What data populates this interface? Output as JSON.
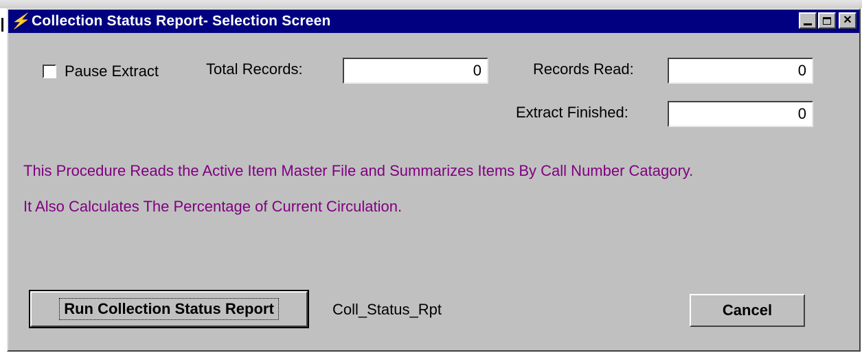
{
  "window": {
    "title": "Collection Status Report- Selection Screen",
    "title_icon": "lightning-icon",
    "controls": [
      "minimize-icon",
      "maximize-icon",
      "close-icon"
    ],
    "close_glyph": "✕"
  },
  "form": {
    "pause_extract_label": "Pause Extract",
    "pause_extract_checked": false,
    "total_records_label": "Total Records:",
    "total_records_value": "0",
    "records_read_label": "Records Read:",
    "records_read_value": "0",
    "extract_finished_label": "Extract Finished:",
    "extract_finished_value": "0"
  },
  "description": {
    "line1": "This Procedure Reads the Active Item Master File and Summarizes Items By Call Number Catagory.",
    "line2": "It Also Calculates The Percentage of Current Circulation.",
    "color": "#800080"
  },
  "actions": {
    "run_label": "Run Collection Status Report",
    "procedure_name": "Coll_Status_Rpt",
    "cancel_label": "Cancel"
  },
  "colors": {
    "titlebar": "#000080",
    "window_bg": "#c0c0c0"
  }
}
